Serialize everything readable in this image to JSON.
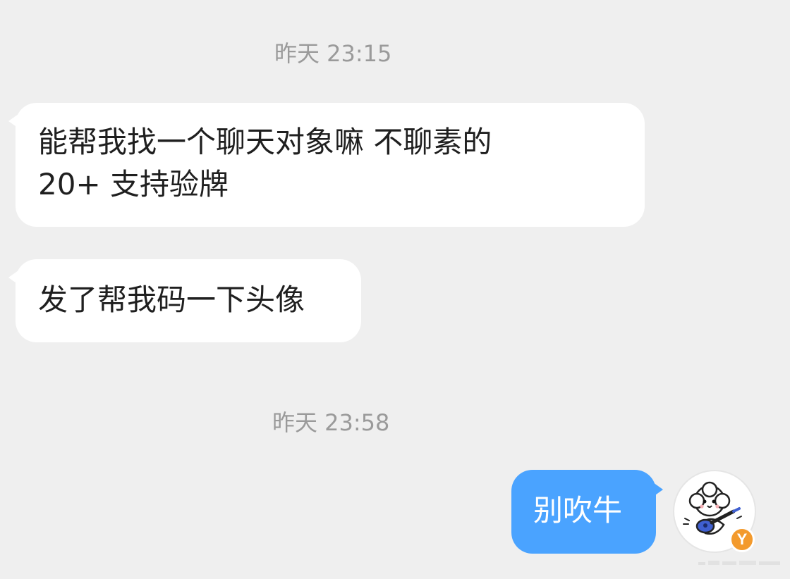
{
  "messages": {
    "time_1": "昨天 23:15",
    "bubble_1_line_1": "能帮我找一个聊天对象嘛  不聊素的",
    "bubble_1_line_2": "20+ 支持验牌",
    "bubble_2": "发了帮我码一下头像",
    "time_2": "昨天 23:58",
    "bubble_3": "别吹牛"
  },
  "avatar": {
    "badge_letter": "Y",
    "icon": "dog-with-guitar-avatar"
  },
  "colors": {
    "background": "#efefef",
    "incoming_bubble": "#ffffff",
    "outgoing_bubble": "#4aa3ff",
    "timestamp_text": "#9a9a9a",
    "badge": "#f39a2d"
  }
}
